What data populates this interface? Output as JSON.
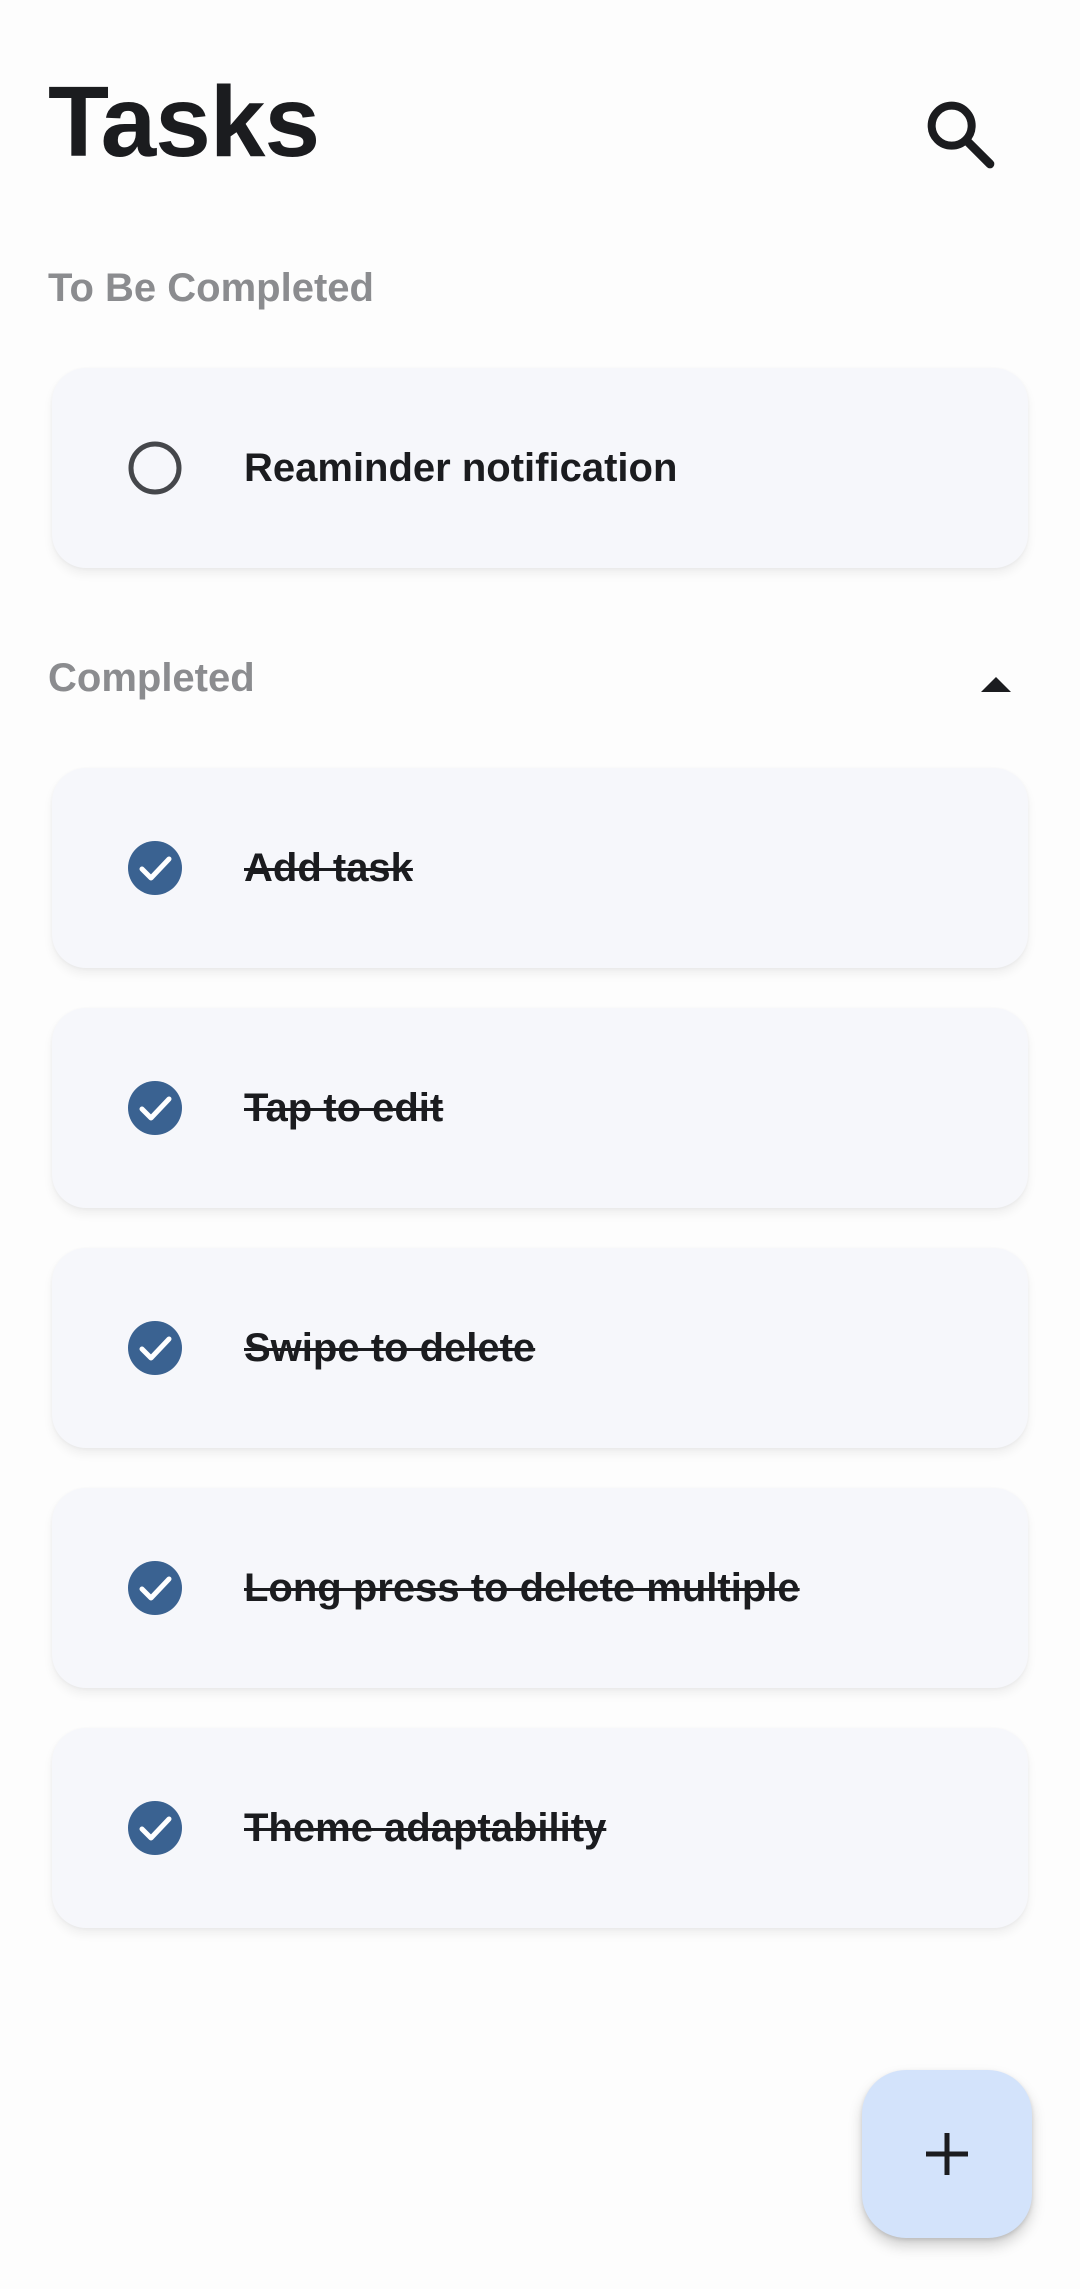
{
  "header": {
    "title": "Tasks",
    "search_icon": "search-icon"
  },
  "sections": {
    "pending": {
      "title": "To Be Completed",
      "tasks": [
        {
          "label": "Reaminder notification",
          "completed": false
        }
      ]
    },
    "completed": {
      "title": "Completed",
      "collapse_icon": "arrow-drop-up-icon",
      "tasks": [
        {
          "label": "Add task",
          "completed": true
        },
        {
          "label": "Tap to edit",
          "completed": true
        },
        {
          "label": "Swipe to delete",
          "completed": true
        },
        {
          "label": "Long press to delete multiple",
          "completed": true
        },
        {
          "label": "Theme adaptability",
          "completed": true
        }
      ]
    }
  },
  "fab": {
    "icon": "plus-icon"
  },
  "colors": {
    "accent": "#3a6291",
    "card_background": "#f6f7fb",
    "fab_background": "#d3e3fb",
    "section_header": "#8b8c8f"
  }
}
